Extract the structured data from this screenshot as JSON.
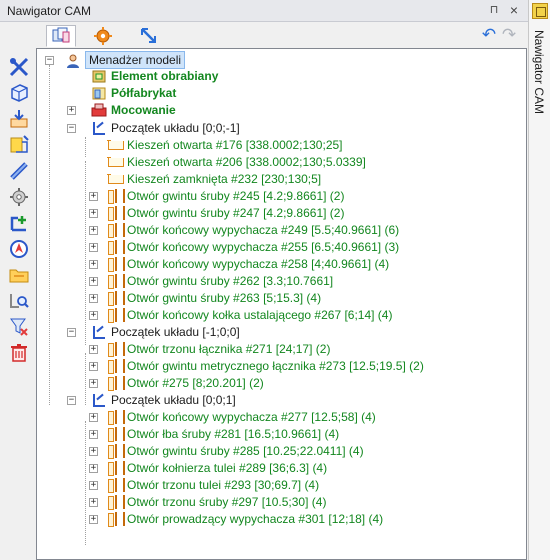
{
  "window": {
    "title": "Nawigator CAM",
    "pin_glyph": "⊓",
    "close_glyph": "×",
    "side_tab_label": "Nawigator CAM"
  },
  "toolbar": {
    "tabs": [
      "models-tab",
      "tools-tab",
      "operations-tab"
    ],
    "undo_glyph": "↶",
    "redo_glyph": "↷"
  },
  "tree": {
    "root": "Menadżer modeli",
    "expander_minus": "−",
    "expander_plus": "+",
    "items": [
      {
        "label": "Element obrabiany"
      },
      {
        "label": "Półfabrykat"
      },
      {
        "label": "Mocowanie"
      },
      {
        "label": "Początek układu [0;0;-1]"
      },
      {
        "label": "Kieszeń otwarta #176 [338.0002;130;25]"
      },
      {
        "label": "Kieszeń otwarta #206 [338.0002;130;5.0339]"
      },
      {
        "label": "Kieszeń zamknięta #232 [230;130;5]"
      },
      {
        "label": "Otwór gwintu śruby #245 [4.2;9.8661] (2)"
      },
      {
        "label": "Otwór gwintu śruby #247 [4.2;9.8661] (2)"
      },
      {
        "label": "Otwór końcowy wypychacza #249 [5.5;40.9661] (6)"
      },
      {
        "label": "Otwór końcowy wypychacza #255 [6.5;40.9661] (3)"
      },
      {
        "label": "Otwór końcowy wypychacza #258 [4;40.9661] (4)"
      },
      {
        "label": "Otwór gwintu śruby #262 [3.3;10.7661]"
      },
      {
        "label": "Otwór gwintu śruby #263 [5;15.3] (4)"
      },
      {
        "label": "Otwór końcowy kołka ustalającego #267 [6;14] (4)"
      },
      {
        "label": "Początek układu [-1;0;0]"
      },
      {
        "label": "Otwór trzonu łącznika #271 [24;17] (2)"
      },
      {
        "label": "Otwór gwintu metrycznego łącznika #273 [12.5;19.5] (2)"
      },
      {
        "label": "Otwór #275 [8;20.201] (2)"
      },
      {
        "label": "Początek układu [0;0;1]"
      },
      {
        "label": "Otwór końcowy wypychacza #277 [12.5;58] (4)"
      },
      {
        "label": "Otwór łba śruby #281 [16.5;10.9661] (4)"
      },
      {
        "label": "Otwór gwintu śruby #285 [10.25;22.0411] (4)"
      },
      {
        "label": "Otwór kołnierza tulei #289 [36;6.3] (4)"
      },
      {
        "label": "Otwór trzonu tulei #293 [30;69.7] (4)"
      },
      {
        "label": "Otwór trzonu śruby #297 [10.5;30] (4)"
      },
      {
        "label": "Otwór prowadzący wypychacza #301 [12;18] (4)"
      }
    ]
  }
}
